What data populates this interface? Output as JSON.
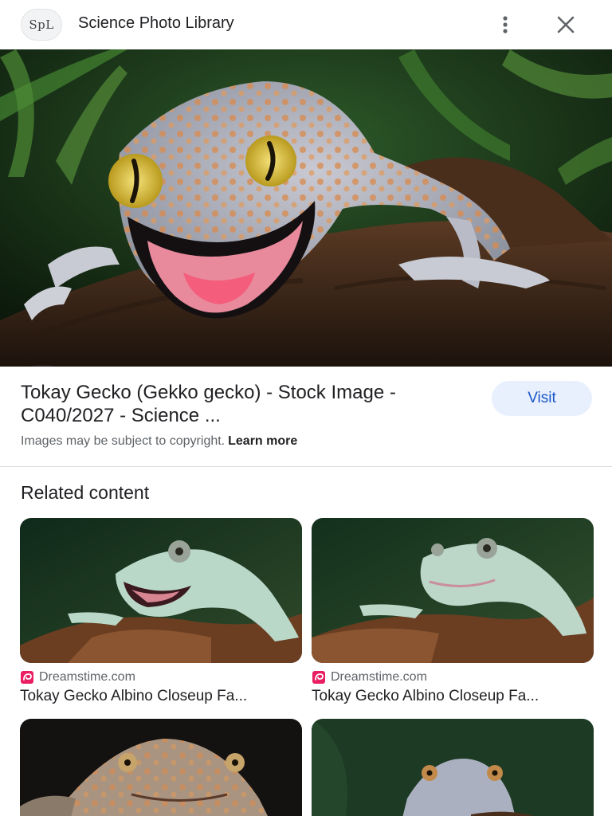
{
  "header": {
    "logo_text": "SpL",
    "site_name": "Science Photo Library",
    "menu_icon": "more-vert-icon",
    "close_icon": "close-icon"
  },
  "hero": {
    "image_alt": "Tokay gecko on a branch",
    "lens_icon": "lens-search-icon"
  },
  "result": {
    "title": "Tokay Gecko (Gekko gecko) - Stock Image - C040/2027 - Science ...",
    "visit_label": "Visit",
    "copyright_text": "Images may be subject to copyright.",
    "learn_more": "Learn more"
  },
  "related": {
    "heading": "Related content",
    "items": [
      {
        "source": "Dreamstime.com",
        "caption": "Tokay Gecko Albino Closeup Fa..."
      },
      {
        "source": "Dreamstime.com",
        "caption": "Tokay Gecko Albino Closeup Fa..."
      }
    ]
  },
  "colors": {
    "visit_bg": "#e8f0fe",
    "visit_text": "#1a56c8",
    "dreamstime_brand": "#e91e63"
  }
}
